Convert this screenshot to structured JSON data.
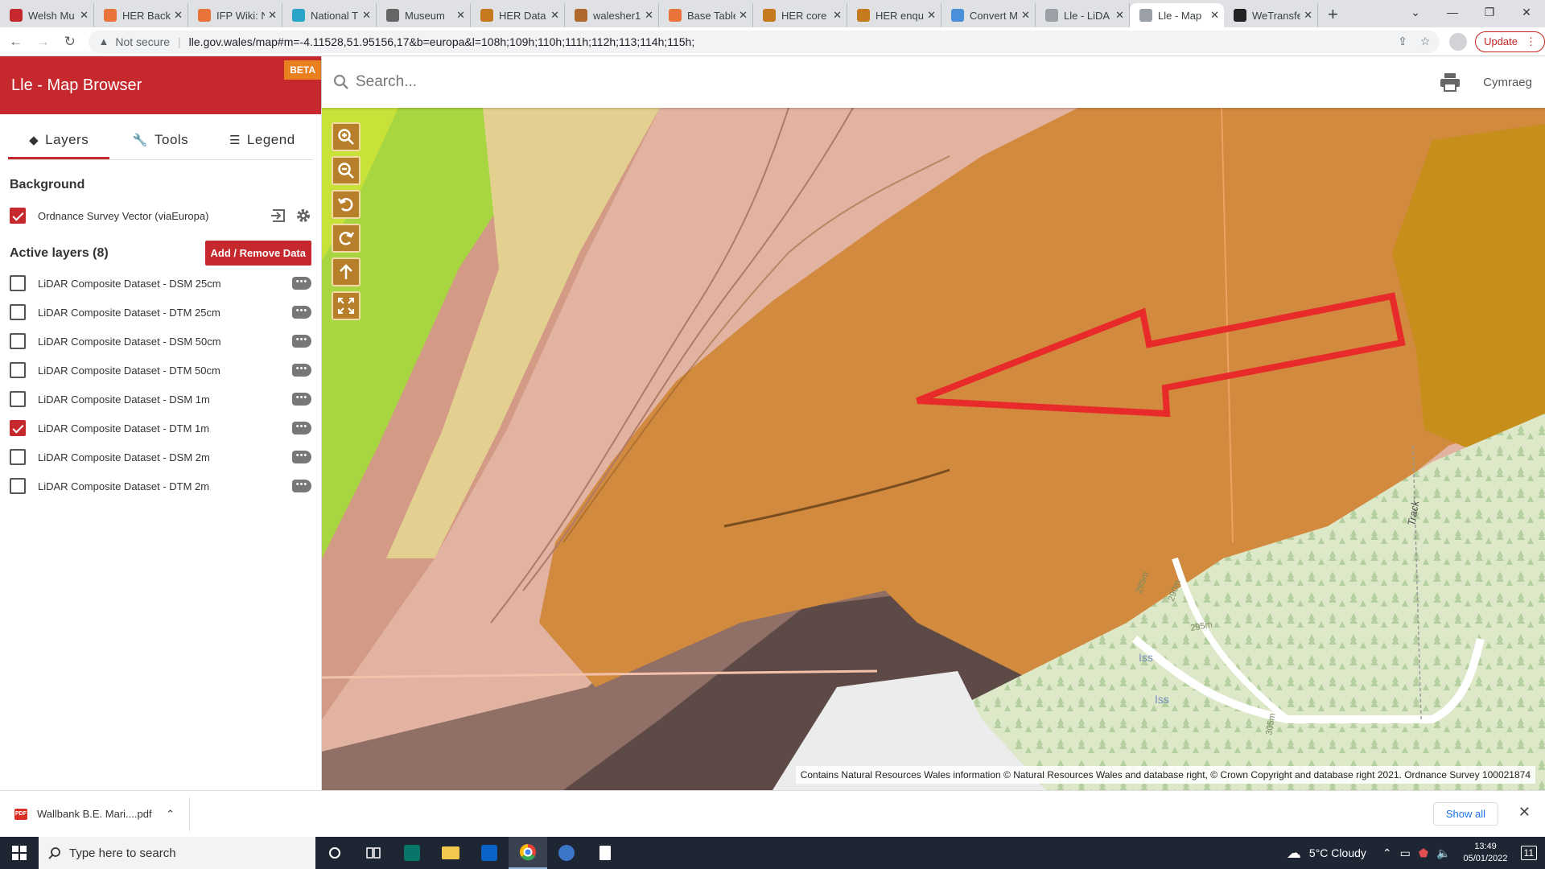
{
  "browser": {
    "tabs": [
      {
        "title": "Welsh Mu",
        "color": "#c5282d"
      },
      {
        "title": "HER Back",
        "color": "#e8743b"
      },
      {
        "title": "IFP Wiki: N",
        "color": "#e8743b"
      },
      {
        "title": "National T",
        "color": "#2aa5c9"
      },
      {
        "title": "Museum",
        "color": "#666666"
      },
      {
        "title": "HER Data",
        "color": "#c57a1e"
      },
      {
        "title": "walesher1",
        "color": "#b0692a"
      },
      {
        "title": "Base Table",
        "color": "#e8743b"
      },
      {
        "title": "HER core",
        "color": "#c57a1e"
      },
      {
        "title": "HER enqu",
        "color": "#c57a1e"
      },
      {
        "title": "Convert M",
        "color": "#4a90d9"
      },
      {
        "title": "Lle - LiDA",
        "color": "#9aa0a6"
      },
      {
        "title": "Lle - Map",
        "color": "#9aa0a6"
      },
      {
        "title": "WeTransfe",
        "color": "#222222"
      }
    ],
    "active_tab": 12,
    "security_label": "Not secure",
    "url": "lle.gov.wales/map#m=-4.11528,51.95156,17&b=europa&l=108h;109h;110h;111h;112h;113;114h;115h;",
    "update_label": "Update"
  },
  "app": {
    "title": "Lle - Map Browser",
    "beta_label": "BETA",
    "search_placeholder": "Search...",
    "language_label": "Cymraeg",
    "tabs": [
      {
        "label": "Layers",
        "icon": "layers-icon"
      },
      {
        "label": "Tools",
        "icon": "wrench-icon"
      },
      {
        "label": "Legend",
        "icon": "list-icon"
      }
    ],
    "background_heading": "Background",
    "background_layer": {
      "label": "Ordnance Survey Vector (viaEuropa)",
      "checked": true
    },
    "active_heading": "Active layers (8)",
    "add_remove_label": "Add / Remove Data",
    "layers": [
      {
        "label": "LiDAR Composite Dataset - DSM 25cm",
        "checked": false
      },
      {
        "label": "LiDAR Composite Dataset - DTM 25cm",
        "checked": false
      },
      {
        "label": "LiDAR Composite Dataset - DSM 50cm",
        "checked": false
      },
      {
        "label": "LiDAR Composite Dataset - DTM 50cm",
        "checked": false
      },
      {
        "label": "LiDAR Composite Dataset - DSM 1m",
        "checked": false
      },
      {
        "label": "LiDAR Composite Dataset - DTM 1m",
        "checked": true
      },
      {
        "label": "LiDAR Composite Dataset - DSM 2m",
        "checked": false
      },
      {
        "label": "LiDAR Composite Dataset - DTM 2m",
        "checked": false
      }
    ],
    "map_controls": [
      "zoom-in-icon",
      "zoom-out-icon",
      "rotate-left-icon",
      "rotate-right-icon",
      "north-arrow-icon",
      "fullscreen-icon"
    ],
    "map_labels": {
      "track": "Track",
      "c285": "285m",
      "c290": "290m",
      "c295": "295m",
      "c305": "305m",
      "iss1": "Iss",
      "iss2": "Iss"
    },
    "attribution": "Contains Natural Resources Wales information © Natural Resources Wales and database right, © Crown Copyright and database right 2021. Ordnance Survey 100021874",
    "accent_color": "#c5282d"
  },
  "downloads": {
    "file": "Wallbank B.E. Mari....pdf",
    "file_type": "PDF",
    "show_all": "Show all"
  },
  "taskbar": {
    "search_placeholder": "Type here to search",
    "weather": "5°C  Cloudy",
    "time": "13:49",
    "date": "05/01/2022",
    "notifications": "11"
  }
}
